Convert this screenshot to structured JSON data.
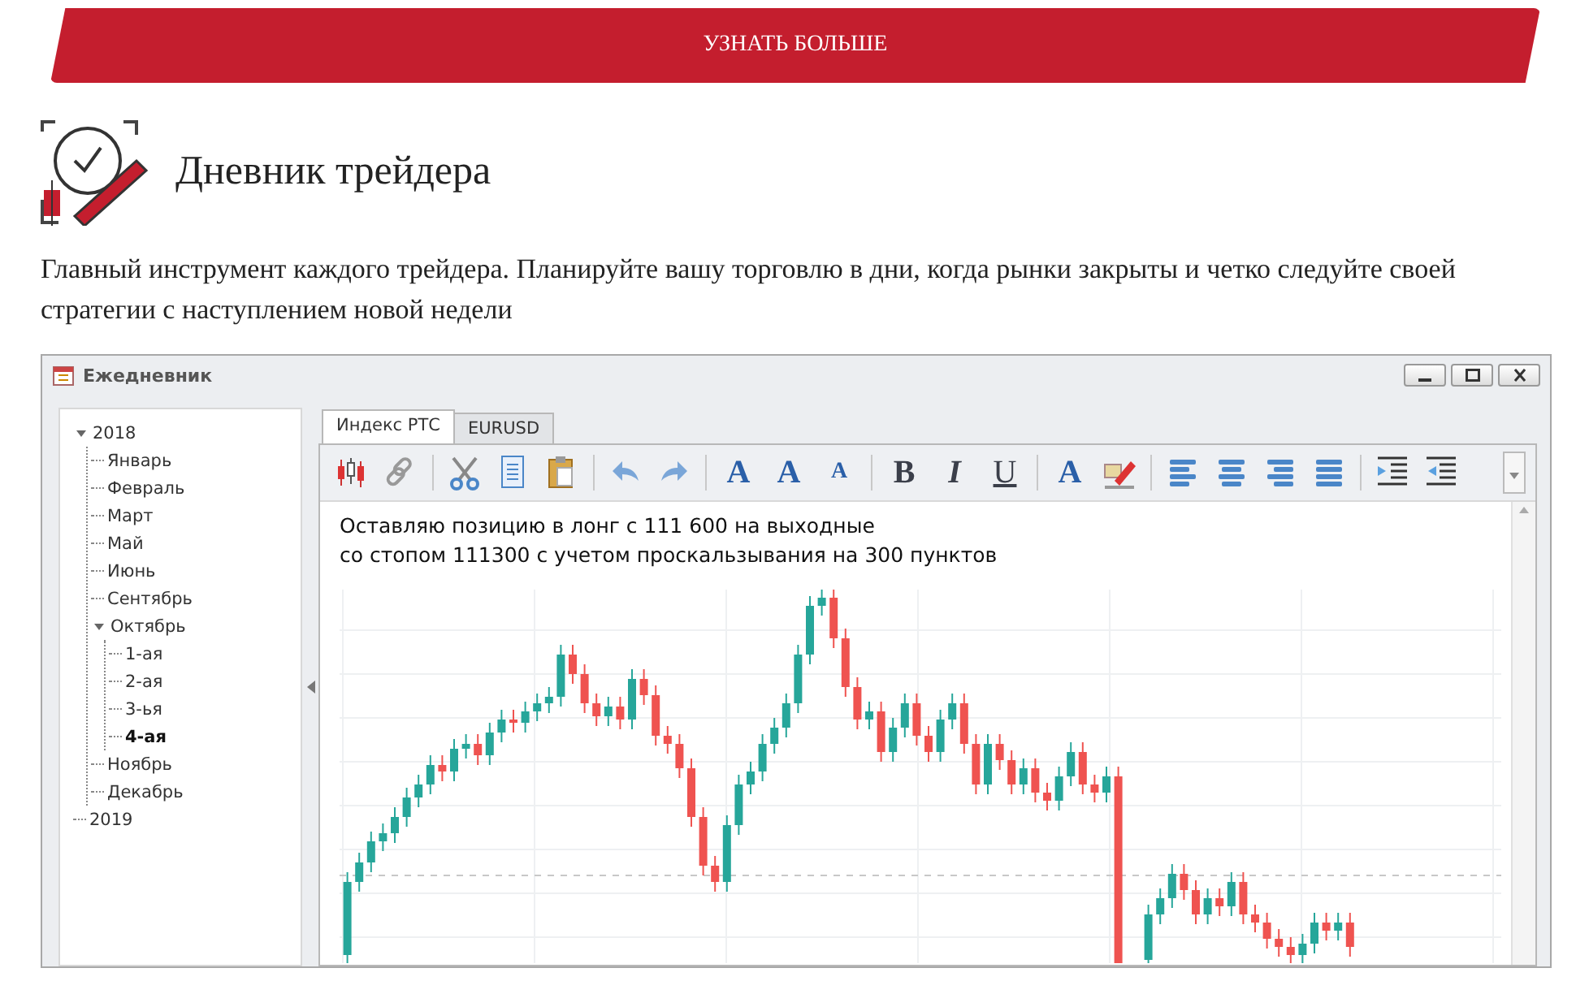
{
  "banner_button": {
    "label": "УЗНАТЬ БОЛЬШЕ"
  },
  "section": {
    "title": "Дневник трейдера",
    "description": "Главный инструмент каждого трейдера. Планируйте вашу торговлю в дни, когда рынки закрыты и четко следуйте своей стратегии с наступлением новой недели"
  },
  "window": {
    "title": "Ежедневник",
    "tree": [
      {
        "label": "2018",
        "selected": false,
        "expanded": true,
        "children": [
          {
            "label": "Январь",
            "selected": false,
            "expanded": false
          },
          {
            "label": "Февраль",
            "selected": false,
            "expanded": false
          },
          {
            "label": "Март",
            "selected": false,
            "expanded": false
          },
          {
            "label": "Май",
            "selected": false,
            "expanded": false
          },
          {
            "label": "Июнь",
            "selected": false,
            "expanded": false
          },
          {
            "label": "Сентябрь",
            "selected": false,
            "expanded": false
          },
          {
            "label": "Октябрь",
            "selected": false,
            "expanded": true,
            "children": [
              {
                "label": "1-ая",
                "selected": false,
                "expanded": false
              },
              {
                "label": "2-ая",
                "selected": false,
                "expanded": false
              },
              {
                "label": "3-ья",
                "selected": false,
                "expanded": false
              },
              {
                "label": "4-ая",
                "selected": true,
                "expanded": false
              }
            ]
          },
          {
            "label": "Ноябрь",
            "selected": false,
            "expanded": false
          },
          {
            "label": "Декабрь",
            "selected": false,
            "expanded": false
          }
        ]
      },
      {
        "label": "2019",
        "selected": false,
        "expanded": false
      }
    ],
    "tabs": [
      {
        "label": "Индекс РТС",
        "selected": true
      },
      {
        "label": "EURUSD",
        "selected": false
      }
    ],
    "toolbar": [
      {
        "kind": "candles"
      },
      {
        "kind": "link"
      },
      {
        "kind": "separator"
      },
      {
        "kind": "cut"
      },
      {
        "kind": "copy"
      },
      {
        "kind": "paste"
      },
      {
        "kind": "separator"
      },
      {
        "kind": "undo"
      },
      {
        "kind": "redo"
      },
      {
        "kind": "separator"
      },
      {
        "kind": "font",
        "glyph": "A"
      },
      {
        "kind": "grow",
        "glyph": "A"
      },
      {
        "kind": "shrink",
        "glyph": "A"
      },
      {
        "kind": "separator"
      },
      {
        "kind": "bold",
        "glyph": "B"
      },
      {
        "kind": "italic",
        "glyph": "I"
      },
      {
        "kind": "underline",
        "glyph": "U"
      },
      {
        "kind": "separator"
      },
      {
        "kind": "color",
        "glyph": "A"
      },
      {
        "kind": "highlight"
      },
      {
        "kind": "separator"
      },
      {
        "kind": "align-left"
      },
      {
        "kind": "align-center"
      },
      {
        "kind": "align-right"
      },
      {
        "kind": "justify"
      },
      {
        "kind": "separator"
      },
      {
        "kind": "indent"
      },
      {
        "kind": "outdent"
      }
    ],
    "note": [
      "Оставляю позицию в лонг с 111 600 на выходные",
      "со стопом 111300 с учетом проскальзывания на 300 пунктов"
    ]
  }
}
